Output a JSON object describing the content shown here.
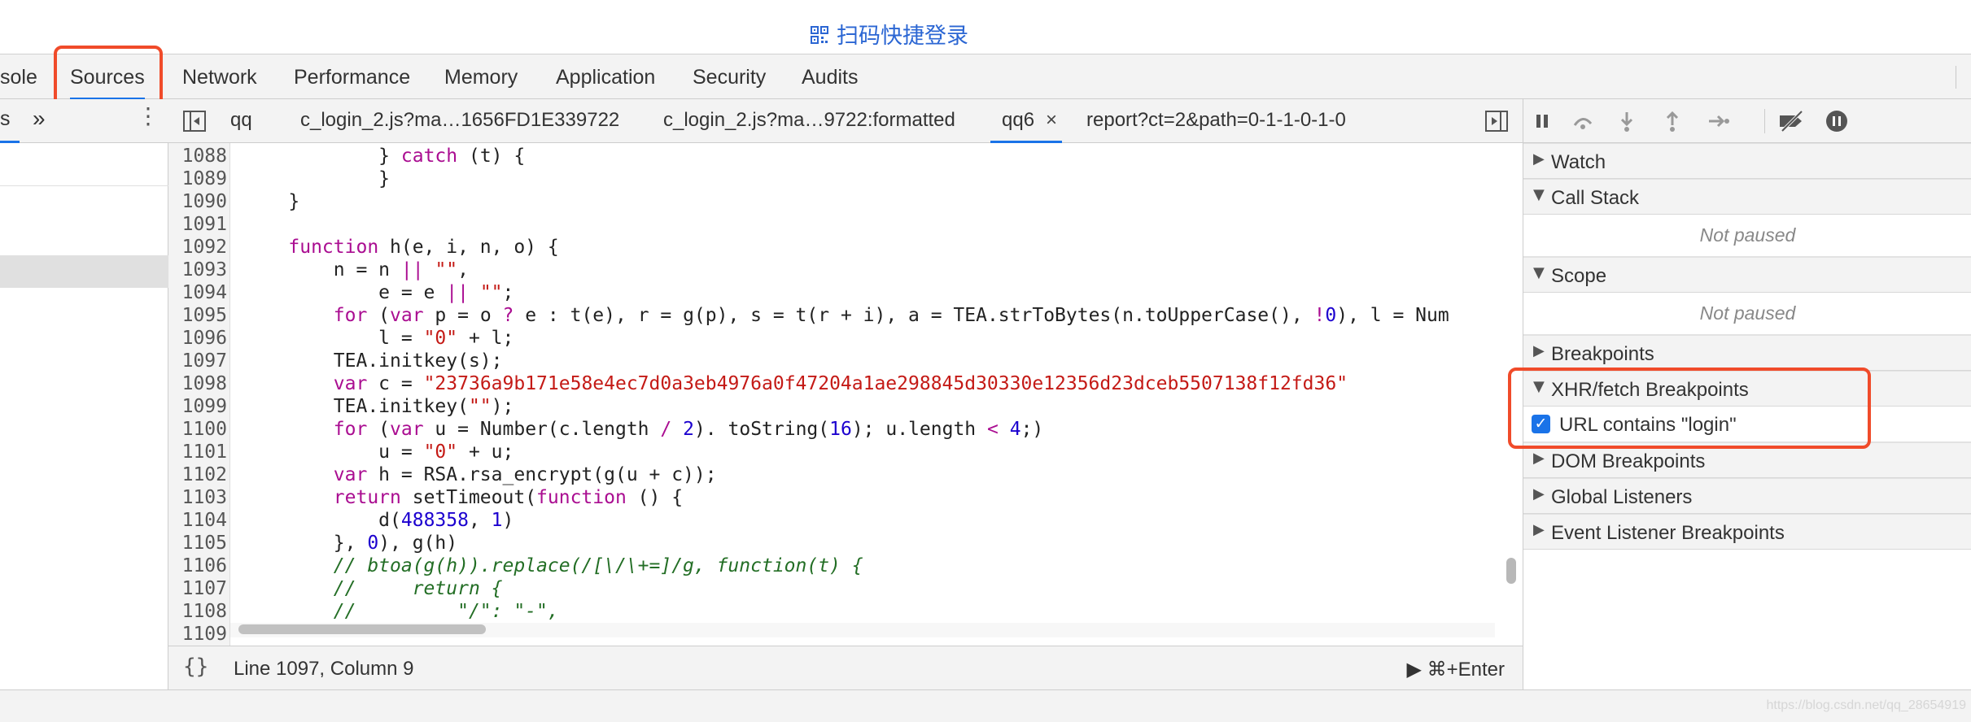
{
  "page": {
    "qr_login_text": "扫码快捷登录"
  },
  "main_tabs": [
    {
      "label": "sole"
    },
    {
      "label": "Sources",
      "active": true
    },
    {
      "label": "Network"
    },
    {
      "label": "Performance"
    },
    {
      "label": "Memory"
    },
    {
      "label": "Application"
    },
    {
      "label": "Security"
    },
    {
      "label": "Audits"
    }
  ],
  "left_panel": {
    "tab_label": "s",
    "more_glyph": "»",
    "menu_glyph": "⋮"
  },
  "editor": {
    "file_tabs": [
      {
        "label": "qq"
      },
      {
        "label": "c_login_2.js?ma…1656FD1E339722"
      },
      {
        "label": "c_login_2.js?ma…9722:formatted"
      },
      {
        "label": "qq6",
        "active": true,
        "close": "×"
      },
      {
        "label": "report?ct=2&path=0-1-1-0-1-0"
      }
    ],
    "lines": [
      {
        "n": "1088",
        "tokens": [
          [
            "id",
            "            } "
          ],
          [
            "kw",
            "catch"
          ],
          [
            "id",
            " (t) {"
          ]
        ]
      },
      {
        "n": "1089",
        "tokens": [
          [
            "id",
            "            }"
          ]
        ]
      },
      {
        "n": "1090",
        "tokens": [
          [
            "id",
            "    }"
          ]
        ]
      },
      {
        "n": "1091",
        "tokens": []
      },
      {
        "n": "1092",
        "tokens": [
          [
            "id",
            "    "
          ],
          [
            "kw",
            "function"
          ],
          [
            "id",
            " h(e, i, n, o) {"
          ]
        ]
      },
      {
        "n": "1093",
        "tokens": [
          [
            "id",
            "        n = n "
          ],
          [
            "kw",
            "||"
          ],
          [
            "id",
            " "
          ],
          [
            "str",
            "\"\""
          ],
          [
            "id",
            ","
          ]
        ]
      },
      {
        "n": "1094",
        "tokens": [
          [
            "id",
            "            e = e "
          ],
          [
            "kw",
            "||"
          ],
          [
            "id",
            " "
          ],
          [
            "str",
            "\"\""
          ],
          [
            "id",
            ";"
          ]
        ]
      },
      {
        "n": "1095",
        "tokens": [
          [
            "id",
            "        "
          ],
          [
            "kw",
            "for"
          ],
          [
            "id",
            " ("
          ],
          [
            "kw",
            "var"
          ],
          [
            "id",
            " p = o "
          ],
          [
            "kw",
            "?"
          ],
          [
            "id",
            " e : t(e), r = g(p), s = t(r + i), a = TEA.strToBytes(n.toUpperCase(), "
          ],
          [
            "kw",
            "!"
          ],
          [
            "num",
            "0"
          ],
          [
            "id",
            "), l = Num"
          ]
        ]
      },
      {
        "n": "1096",
        "tokens": [
          [
            "id",
            "            l = "
          ],
          [
            "str",
            "\"0\""
          ],
          [
            "id",
            " + l;"
          ]
        ]
      },
      {
        "n": "1097",
        "tokens": [
          [
            "id",
            "        TEA.initkey(s);"
          ]
        ]
      },
      {
        "n": "1098",
        "tokens": [
          [
            "id",
            "        "
          ],
          [
            "kw",
            "var"
          ],
          [
            "id",
            " c = "
          ],
          [
            "str",
            "\"23736a9b171e58e4ec7d0a3eb4976a0f47204a1ae298845d30330e12356d23dceb5507138f12fd36\""
          ]
        ]
      },
      {
        "n": "1099",
        "tokens": [
          [
            "id",
            "        TEA.initkey("
          ],
          [
            "str",
            "\"\""
          ],
          [
            "id",
            ");"
          ]
        ]
      },
      {
        "n": "1100",
        "tokens": [
          [
            "id",
            "        "
          ],
          [
            "kw",
            "for"
          ],
          [
            "id",
            " ("
          ],
          [
            "kw",
            "var"
          ],
          [
            "id",
            " u = Number(c.length "
          ],
          [
            "kw",
            "/"
          ],
          [
            "id",
            " "
          ],
          [
            "num",
            "2"
          ],
          [
            "id",
            "). toString("
          ],
          [
            "num",
            "16"
          ],
          [
            "id",
            "); u.length "
          ],
          [
            "kw",
            "<"
          ],
          [
            "id",
            " "
          ],
          [
            "num",
            "4"
          ],
          [
            "id",
            ";)"
          ]
        ]
      },
      {
        "n": "1101",
        "tokens": [
          [
            "id",
            "            u = "
          ],
          [
            "str",
            "\"0\""
          ],
          [
            "id",
            " + u;"
          ]
        ]
      },
      {
        "n": "1102",
        "tokens": [
          [
            "id",
            "        "
          ],
          [
            "kw",
            "var"
          ],
          [
            "id",
            " h = RSA.rsa_encrypt(g(u + c));"
          ]
        ]
      },
      {
        "n": "1103",
        "tokens": [
          [
            "id",
            "        "
          ],
          [
            "kw",
            "return"
          ],
          [
            "id",
            " setTimeout("
          ],
          [
            "kw",
            "function"
          ],
          [
            "id",
            " () {"
          ]
        ]
      },
      {
        "n": "1104",
        "tokens": [
          [
            "id",
            "            d("
          ],
          [
            "num",
            "488358"
          ],
          [
            "id",
            ", "
          ],
          [
            "num",
            "1"
          ],
          [
            "id",
            ")"
          ]
        ]
      },
      {
        "n": "1105",
        "tokens": [
          [
            "id",
            "        }, "
          ],
          [
            "num",
            "0"
          ],
          [
            "id",
            "), g(h)"
          ]
        ]
      },
      {
        "n": "1106",
        "tokens": [
          [
            "id",
            "        "
          ],
          [
            "cmt",
            "// btoa(g(h)).replace(/[\\/\\+=]/g, function(t) {"
          ]
        ]
      },
      {
        "n": "1107",
        "tokens": [
          [
            "id",
            "        "
          ],
          [
            "cmt",
            "//     return {"
          ]
        ]
      },
      {
        "n": "1108",
        "tokens": [
          [
            "id",
            "        "
          ],
          [
            "cmt",
            "//         \"/\": \"-\","
          ]
        ]
      },
      {
        "n": "1109",
        "tokens": []
      }
    ]
  },
  "status_bar": {
    "braces": "{}",
    "position": "Line 1097, Column 9",
    "run_shortcut": "▶ ⌘+Enter"
  },
  "sidebar": {
    "sections": {
      "watch": "Watch",
      "call_stack": "Call Stack",
      "call_stack_note": "Not paused",
      "scope": "Scope",
      "scope_note": "Not paused",
      "breakpoints": "Breakpoints",
      "xhr": "XHR/fetch Breakpoints",
      "xhr_item": "URL contains \"login\"",
      "dom": "DOM Breakpoints",
      "global": "Global Listeners",
      "event": "Event Listener Breakpoints"
    },
    "triangles": {
      "collapsed": "▶",
      "expanded": "▼"
    }
  },
  "watermark": "https://blog.csdn.net/qq_28654919",
  "colors": {
    "annotation": "#f04b2a",
    "active_tab": "#1a73e8",
    "keyword": "#aa0d91",
    "string": "#c41a16",
    "number": "#1c00cf",
    "comment": "#236e25"
  }
}
